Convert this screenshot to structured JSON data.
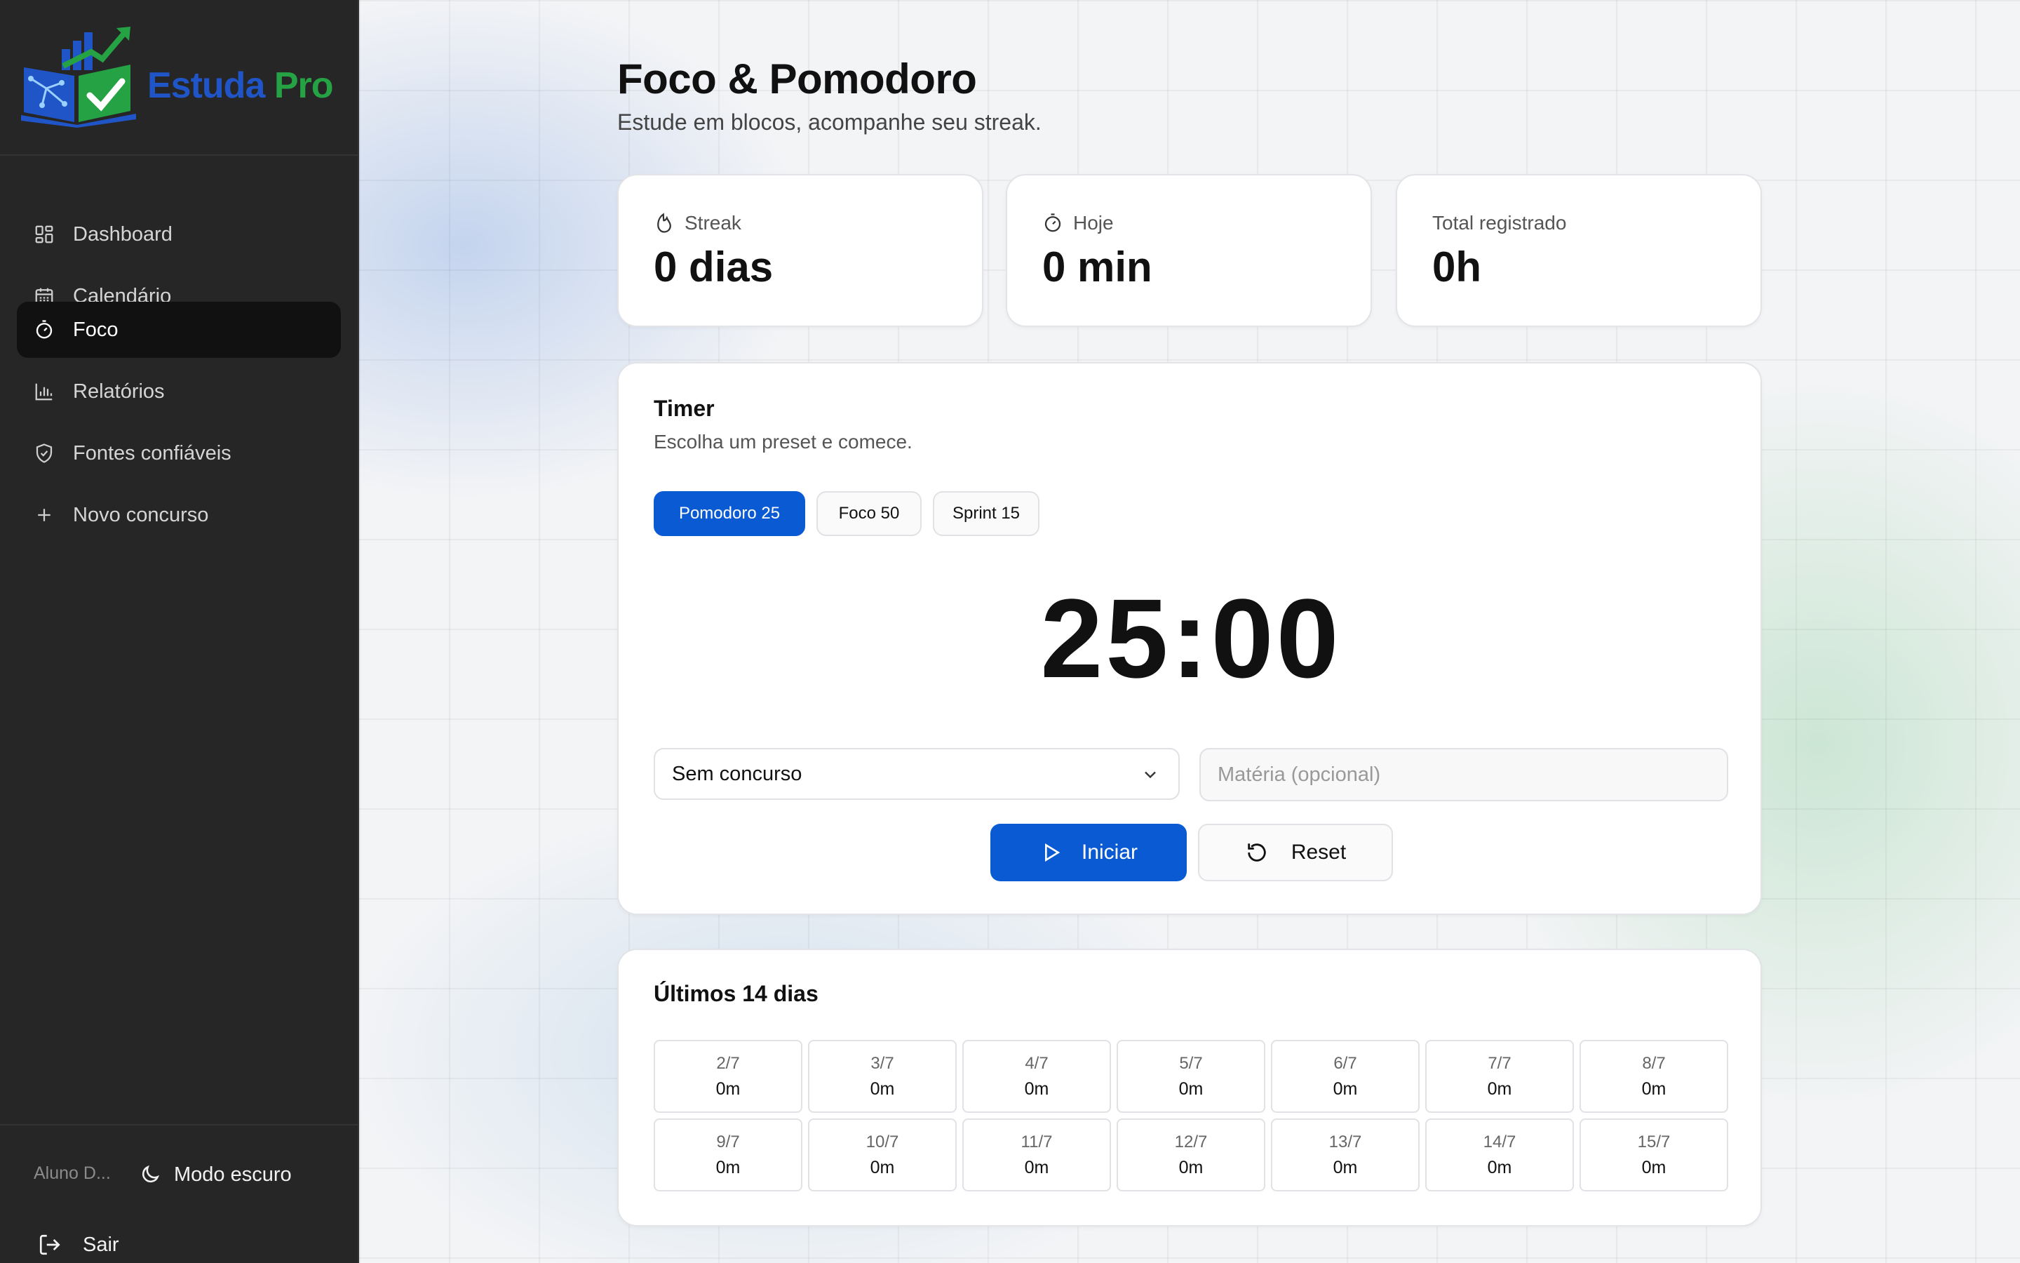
{
  "app": {
    "logo_part1": "Estuda",
    "logo_part2": "Pro",
    "brand_colors": {
      "blue": "#1f55c6",
      "green": "#25a244"
    }
  },
  "sidebar": {
    "items": [
      {
        "label": "Dashboard",
        "icon": "dashboard-grid-icon",
        "active": false
      },
      {
        "label": "Calendário",
        "icon": "calendar-icon",
        "active": false
      },
      {
        "label": "Foco",
        "icon": "timer-icon",
        "active": true
      },
      {
        "label": "Relatórios",
        "icon": "bar-chart-icon",
        "active": false
      },
      {
        "label": "Fontes confiáveis",
        "icon": "shield-check-icon",
        "active": false
      },
      {
        "label": "Novo concurso",
        "icon": "plus-icon",
        "active": false
      }
    ],
    "user_name": "Aluno D...",
    "dark_mode_label": "Modo escuro",
    "logout_label": "Sair"
  },
  "page": {
    "title": "Foco & Pomodoro",
    "subtitle": "Estude em blocos, acompanhe seu streak."
  },
  "stats": [
    {
      "label": "Streak",
      "value": "0 dias",
      "icon": "flame-icon"
    },
    {
      "label": "Hoje",
      "value": "0 min",
      "icon": "stopwatch-icon"
    },
    {
      "label": "Total registrado",
      "value": "0h",
      "icon": ""
    }
  ],
  "timer": {
    "title": "Timer",
    "subtitle": "Escolha um preset e comece.",
    "presets": [
      {
        "label": "Pomodoro 25",
        "active": true
      },
      {
        "label": "Foco 50",
        "active": false
      },
      {
        "label": "Sprint 15",
        "active": false
      }
    ],
    "display": "25:00",
    "contest_select": "Sem concurso",
    "subject_placeholder": "Matéria (opcional)",
    "subject_value": "",
    "start_label": "Iniciar",
    "reset_label": "Reset",
    "accent_color": "#0a5bd3"
  },
  "history": {
    "title": "Últimos 14 dias",
    "days": [
      {
        "date": "2/7",
        "minutes": "0m"
      },
      {
        "date": "3/7",
        "minutes": "0m"
      },
      {
        "date": "4/7",
        "minutes": "0m"
      },
      {
        "date": "5/7",
        "minutes": "0m"
      },
      {
        "date": "6/7",
        "minutes": "0m"
      },
      {
        "date": "7/7",
        "minutes": "0m"
      },
      {
        "date": "8/7",
        "minutes": "0m"
      },
      {
        "date": "9/7",
        "minutes": "0m"
      },
      {
        "date": "10/7",
        "minutes": "0m"
      },
      {
        "date": "11/7",
        "minutes": "0m"
      },
      {
        "date": "12/7",
        "minutes": "0m"
      },
      {
        "date": "13/7",
        "minutes": "0m"
      },
      {
        "date": "14/7",
        "minutes": "0m"
      },
      {
        "date": "15/7",
        "minutes": "0m"
      }
    ]
  }
}
